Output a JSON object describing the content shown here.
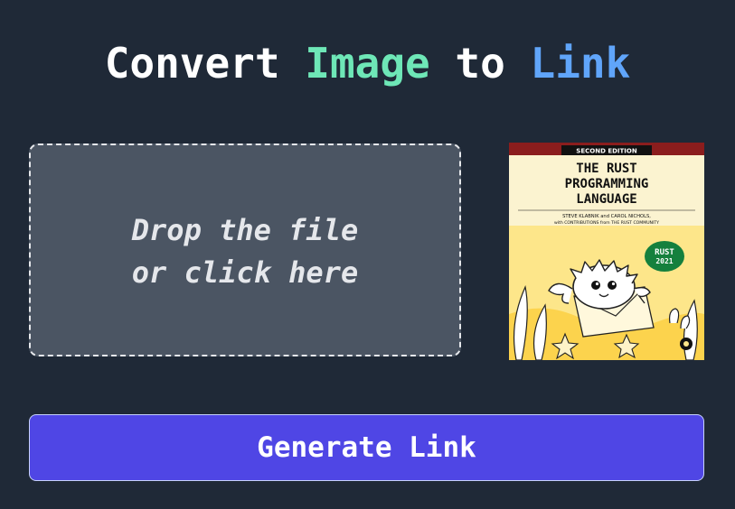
{
  "title": {
    "part1": "Convert ",
    "part2": "Image",
    "part3": " to ",
    "part4": "Link"
  },
  "dropzone": {
    "line1": "Drop the file",
    "line2": "or click here"
  },
  "preview": {
    "edition": "SECOND EDITION",
    "title_line1": "THE RUST",
    "title_line2": "PROGRAMMING",
    "title_line3": "LANGUAGE",
    "authors_line1": "STEVE KLABNIK and CAROL NICHOLS,",
    "authors_line2": "with CONTRIBUTIONS from THE RUST COMMUNITY",
    "badge_line1": "RUST",
    "badge_line2": "2021"
  },
  "generate_button": {
    "label": "Generate Link"
  },
  "colors": {
    "background": "#1f2937",
    "accent_green": "#6ee7b7",
    "accent_blue": "#60a5fa",
    "button": "#4f46e5"
  }
}
